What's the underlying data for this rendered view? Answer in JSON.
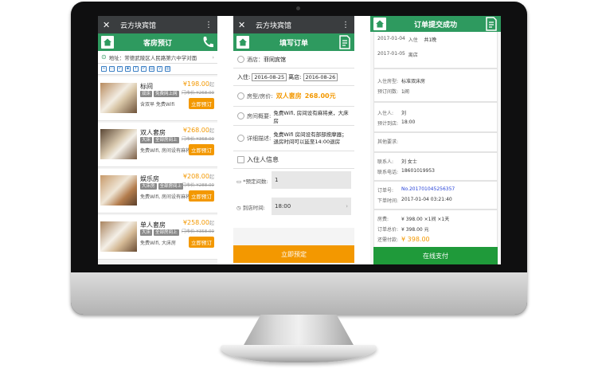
{
  "panel1": {
    "window_title": "云方块宾馆",
    "header": "客房预订",
    "address": "地址：常德武陵区人民路第六中学对面",
    "amenity_icons": [
      "wifi-icon",
      "tv-icon",
      "parking-icon",
      "lock-icon",
      "meal-icon",
      "parking-icon",
      "towel-icon",
      "drink-icon",
      "luggage-icon"
    ],
    "rooms": [
      {
        "name": "标间",
        "price": "¥198.00",
        "price_unit": "起",
        "orig": "门市价 ¥268.00",
        "tags": [
          "双床",
          "免费网上网",
          "有窗"
        ],
        "desc": "含双早 免费Wifi",
        "button": "立即预订"
      },
      {
        "name": "双人套房",
        "price": "¥268.00",
        "price_unit": "起",
        "orig": "门市价 ¥368.00",
        "tags": [
          "大床",
          "全部房间上",
          "有窗"
        ],
        "desc": "免费Wifi, 房间设有麻将桌...",
        "button": "立即预订"
      },
      {
        "name": "娱乐房",
        "price": "¥208.00",
        "price_unit": "起",
        "orig": "门市价 ¥288.00",
        "tags": [
          "大床房",
          "全部房间上",
          "有窗"
        ],
        "desc": "免费Wifi, 房间设有麻将桌...",
        "button": "立即预订"
      },
      {
        "name": "单人套房",
        "price": "¥258.00",
        "price_unit": "起",
        "orig": "门市价 ¥358.00",
        "tags": [
          "大床",
          "全部房间上",
          "有窗"
        ],
        "desc": "免费Wifi, 大床房",
        "button": "立即预订"
      }
    ]
  },
  "panel2": {
    "window_title": "云方块宾馆",
    "header": "填写订单",
    "hotel_label": "酒店：",
    "hotel_name": "菲同宾馆",
    "checkin_label": "入住:",
    "checkin_date": "2016-08-25",
    "checkout_label": "离店:",
    "checkout_date": "2016-08-26",
    "room_label": "房型/房价:",
    "room_type": "双人套房",
    "room_price": "268.00元",
    "overview_label": "房间概要:",
    "overview": "免费Wifi, 房间设有麻将桌，大床房",
    "detail_label": "详细描述:",
    "detail": "免费Wifi 房间设有部部按摩器；退房时间可以延至14:00退房",
    "guest_section": "入住人信息",
    "rooms_label": "*预定间数:",
    "rooms_value": "1",
    "arrive_label": "到店时间:",
    "arrive_value": "18:00",
    "submit": "立即预定"
  },
  "panel3": {
    "header": "订单提交成功",
    "checkin_date": "2017-01-04",
    "checkin_word": "入住",
    "nights": "共1晚",
    "checkout_date": "2017-01-05",
    "checkout_word": "离店",
    "rows1": [
      {
        "k": "入住房型:",
        "v": "标准双床房"
      },
      {
        "k": "预订间数:",
        "v": "1间"
      }
    ],
    "rows2": [
      {
        "k": "入住人:",
        "v": "刘"
      },
      {
        "k": "预计到店:",
        "v": "18:00"
      }
    ],
    "rows3": [
      {
        "k": "其他要求:",
        "v": ""
      }
    ],
    "rows4": [
      {
        "k": "联系人:",
        "v": "刘   女士"
      },
      {
        "k": "联系电话:",
        "v": "18601019953"
      }
    ],
    "rows5": [
      {
        "k": "订单号:",
        "v": "No.20170104525635​7"
      },
      {
        "k": "下单时间:",
        "v": "2017-01-04 03:21:40"
      }
    ],
    "rows6": [
      {
        "k": "房费:",
        "v": "¥ 398.00 ×1间 ×1天"
      },
      {
        "k": "订单总价:",
        "v": "¥ 398.00 元"
      },
      {
        "k": "还需付款:",
        "v": "¥ 398.00"
      }
    ],
    "pay_button": "在线支付"
  }
}
